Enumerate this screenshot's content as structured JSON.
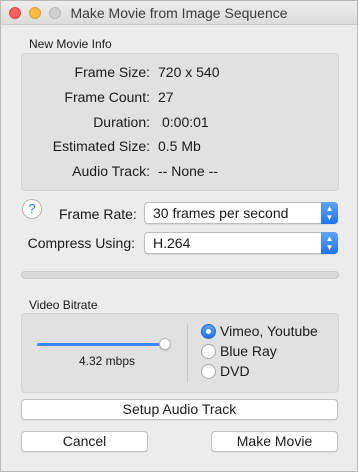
{
  "window": {
    "title": "Make Movie from Image Sequence"
  },
  "info": {
    "section_label": "New Movie Info",
    "rows": [
      {
        "label": "Frame Size:",
        "value": "720 x 540"
      },
      {
        "label": "Frame Count:",
        "value": "27"
      },
      {
        "label": "Duration:",
        "value": "0:00:01"
      },
      {
        "label": "Estimated Size:",
        "value": "0.5 Mb"
      },
      {
        "label": "Audio Track:",
        "value": "-- None --"
      }
    ]
  },
  "help": {
    "glyph": "?"
  },
  "frame_rate": {
    "label": "Frame Rate:",
    "value": "30 frames per second"
  },
  "compress": {
    "label": "Compress Using:",
    "value": "H.264"
  },
  "progress": {
    "fraction": 0
  },
  "bitrate": {
    "section_label": "Video Bitrate",
    "value_text": "4.32 mbps",
    "slider_fraction": 1.0,
    "options": [
      {
        "label": "Vimeo, Youtube",
        "selected": true
      },
      {
        "label": "Blue Ray",
        "selected": false
      },
      {
        "label": "DVD",
        "selected": false
      }
    ]
  },
  "buttons": {
    "setup_audio": "Setup Audio Track",
    "cancel": "Cancel",
    "make_movie": "Make Movie"
  },
  "colors": {
    "accent": "#1f73ee",
    "help_text": "#2a7ff5"
  }
}
